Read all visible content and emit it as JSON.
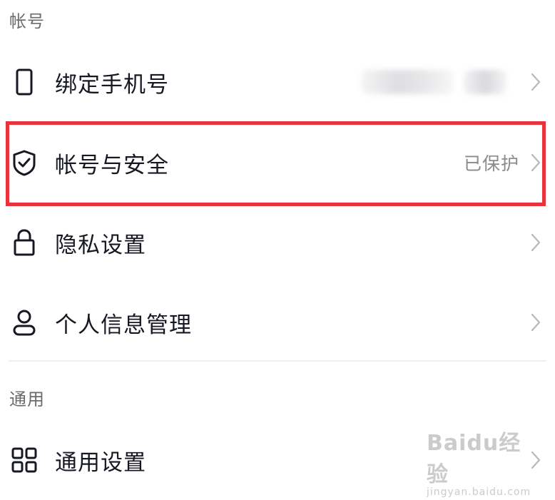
{
  "sections": [
    {
      "header": "帐号",
      "items": [
        {
          "label": "绑定手机号",
          "icon": "phone-icon",
          "value": ""
        },
        {
          "label": "帐号与安全",
          "icon": "shield-check-icon",
          "value": "已保护"
        },
        {
          "label": "隐私设置",
          "icon": "lock-icon",
          "value": ""
        },
        {
          "label": "个人信息管理",
          "icon": "user-icon",
          "value": ""
        }
      ]
    },
    {
      "header": "通用",
      "items": [
        {
          "label": "通用设置",
          "icon": "grid-icon",
          "value": ""
        }
      ]
    }
  ],
  "highlight_color": "#e8333a",
  "watermark": {
    "logo": "Baidu经验",
    "url": "jingyan.baidu.com"
  }
}
